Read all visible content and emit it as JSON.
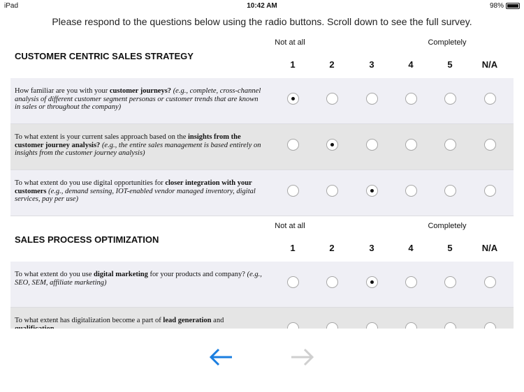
{
  "status": {
    "device": "iPad",
    "time": "10:42 AM",
    "battery": "98%",
    "battery_level": 0.98
  },
  "instruction": "Please respond to the questions below using the radio buttons. Scroll down to see the full survey.",
  "scale": {
    "low": "Not at all",
    "high": "Completely",
    "options": [
      "1",
      "2",
      "3",
      "4",
      "5",
      "N/A"
    ]
  },
  "sections": [
    {
      "title": "CUSTOMER CENTRIC SALES STRATEGY",
      "questions": [
        {
          "parts": [
            {
              "t": "How familiar are you with your ",
              "s": "n"
            },
            {
              "t": "customer journeys?",
              "s": "b"
            },
            {
              "t": " (e.g., complete, cross-channel analysis of different customer segment personas or customer trends that are known in sales or throughout the company)",
              "s": "i"
            }
          ],
          "selected": "1"
        },
        {
          "parts": [
            {
              "t": "To what extent is your current sales approach based on the ",
              "s": "n"
            },
            {
              "t": "insights from the customer journey analysis?",
              "s": "b"
            },
            {
              "t": " (e.g., the entire sales management is based entirely on insights from the customer journey analysis)",
              "s": "i"
            }
          ],
          "selected": "2"
        },
        {
          "parts": [
            {
              "t": "To what extent do you use digital opportunities for ",
              "s": "n"
            },
            {
              "t": "closer integration with your customers",
              "s": "b"
            },
            {
              "t": " (e.g., demand sensing, IOT-enabled vendor managed inventory, digital services, pay per use)",
              "s": "i"
            }
          ],
          "selected": "3"
        }
      ]
    },
    {
      "title": "SALES PROCESS OPTIMIZATION",
      "questions": [
        {
          "parts": [
            {
              "t": "To what extent do you use ",
              "s": "n"
            },
            {
              "t": "digital marketing",
              "s": "b"
            },
            {
              "t": " for your products and company? ",
              "s": "n"
            },
            {
              "t": "(e.g., SEO, SEM, affiliate marketing)",
              "s": "i"
            }
          ],
          "selected": "3"
        },
        {
          "parts": [
            {
              "t": "To what extent has digitalization become a part of ",
              "s": "n"
            },
            {
              "t": "lead generation",
              "s": "b"
            },
            {
              "t": " and ",
              "s": "n"
            },
            {
              "t": "qualification",
              "s": "b"
            }
          ],
          "selected": null
        }
      ]
    }
  ],
  "nav": {
    "back_icon": "arrow-left-icon",
    "next_icon": "arrow-right-icon",
    "back_color": "#1a7ee0",
    "next_color": "#cfcfcf"
  }
}
